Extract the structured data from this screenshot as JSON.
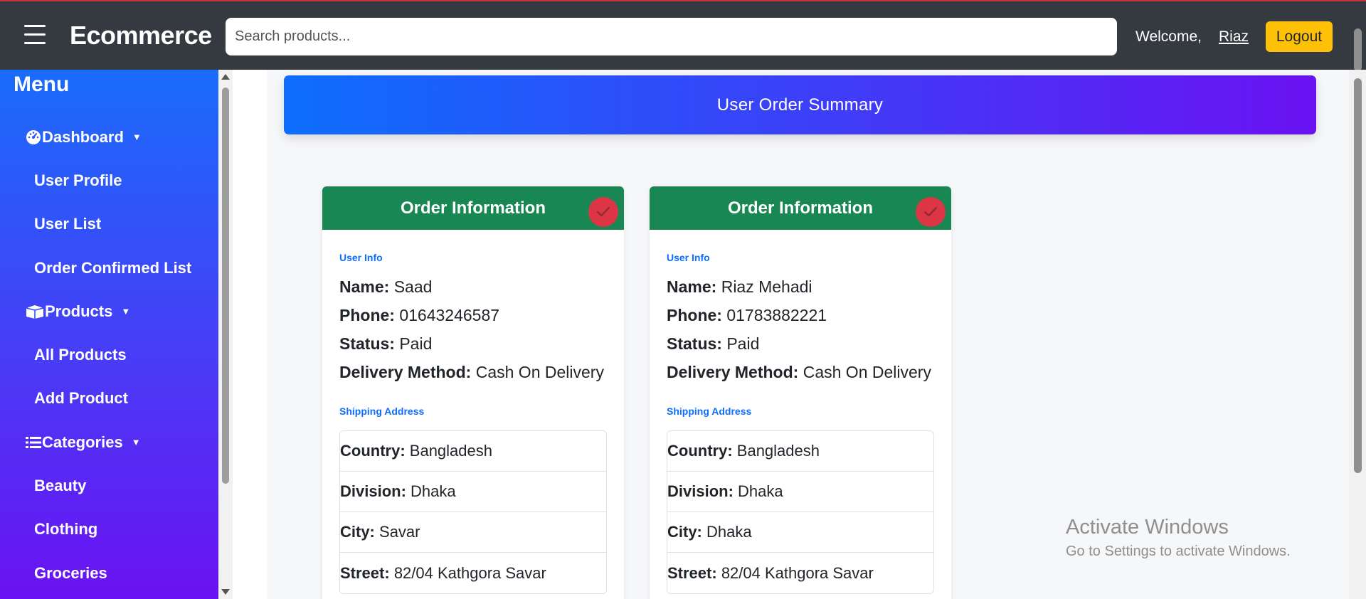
{
  "header": {
    "brand": "Ecommerce",
    "search_placeholder": "Search products...",
    "welcome": "Welcome,",
    "username": "Riaz",
    "logout": "Logout"
  },
  "sidebar": {
    "title": "Menu",
    "items": [
      {
        "label": "Dashboard",
        "type": "head",
        "icon": "dashboard-gauge-icon"
      },
      {
        "label": "User Profile",
        "type": "sub"
      },
      {
        "label": "User List",
        "type": "sub"
      },
      {
        "label": "Order Confirmed List",
        "type": "sub"
      },
      {
        "label": "Products",
        "type": "head",
        "icon": "box-open-icon"
      },
      {
        "label": "All Products",
        "type": "sub"
      },
      {
        "label": "Add Product",
        "type": "sub"
      },
      {
        "label": "Categories",
        "type": "head",
        "icon": "list-icon"
      },
      {
        "label": "Beauty",
        "type": "sub"
      },
      {
        "label": "Clothing",
        "type": "sub"
      },
      {
        "label": "Groceries",
        "type": "sub"
      }
    ]
  },
  "main": {
    "banner_title": "User Order Summary",
    "cards": [
      {
        "header": "Order Information",
        "user_info_label": "User Info",
        "name_label": "Name:",
        "name": "Saad",
        "phone_label": "Phone:",
        "phone": "01643246587",
        "status_label": "Status:",
        "status": "Paid",
        "delivery_label": "Delivery Method:",
        "delivery": "Cash On Delivery",
        "shipping_label": "Shipping Address",
        "country_label": "Country:",
        "country": "Bangladesh",
        "division_label": "Division:",
        "division": "Dhaka",
        "city_label": "City:",
        "city": "Savar",
        "street_label": "Street:",
        "street": "82/04 Kathgora Savar"
      },
      {
        "header": "Order Information",
        "user_info_label": "User Info",
        "name_label": "Name:",
        "name": "Riaz Mehadi",
        "phone_label": "Phone:",
        "phone": "01783882221",
        "status_label": "Status:",
        "status": "Paid",
        "delivery_label": "Delivery Method:",
        "delivery": "Cash On Delivery",
        "shipping_label": "Shipping Address",
        "country_label": "Country:",
        "country": "Bangladesh",
        "division_label": "Division:",
        "division": "Dhaka",
        "city_label": "City:",
        "city": "Dhaka",
        "street_label": "Street:",
        "street": "82/04 Kathgora Savar"
      }
    ]
  },
  "watermark": {
    "title": "Activate Windows",
    "subtitle": "Go to Settings to activate Windows."
  },
  "colors": {
    "navbar": "#343a40",
    "card_header": "#198754",
    "badge": "#dc3545",
    "accent_blue": "#0d6efd",
    "logout": "#ffc107"
  }
}
